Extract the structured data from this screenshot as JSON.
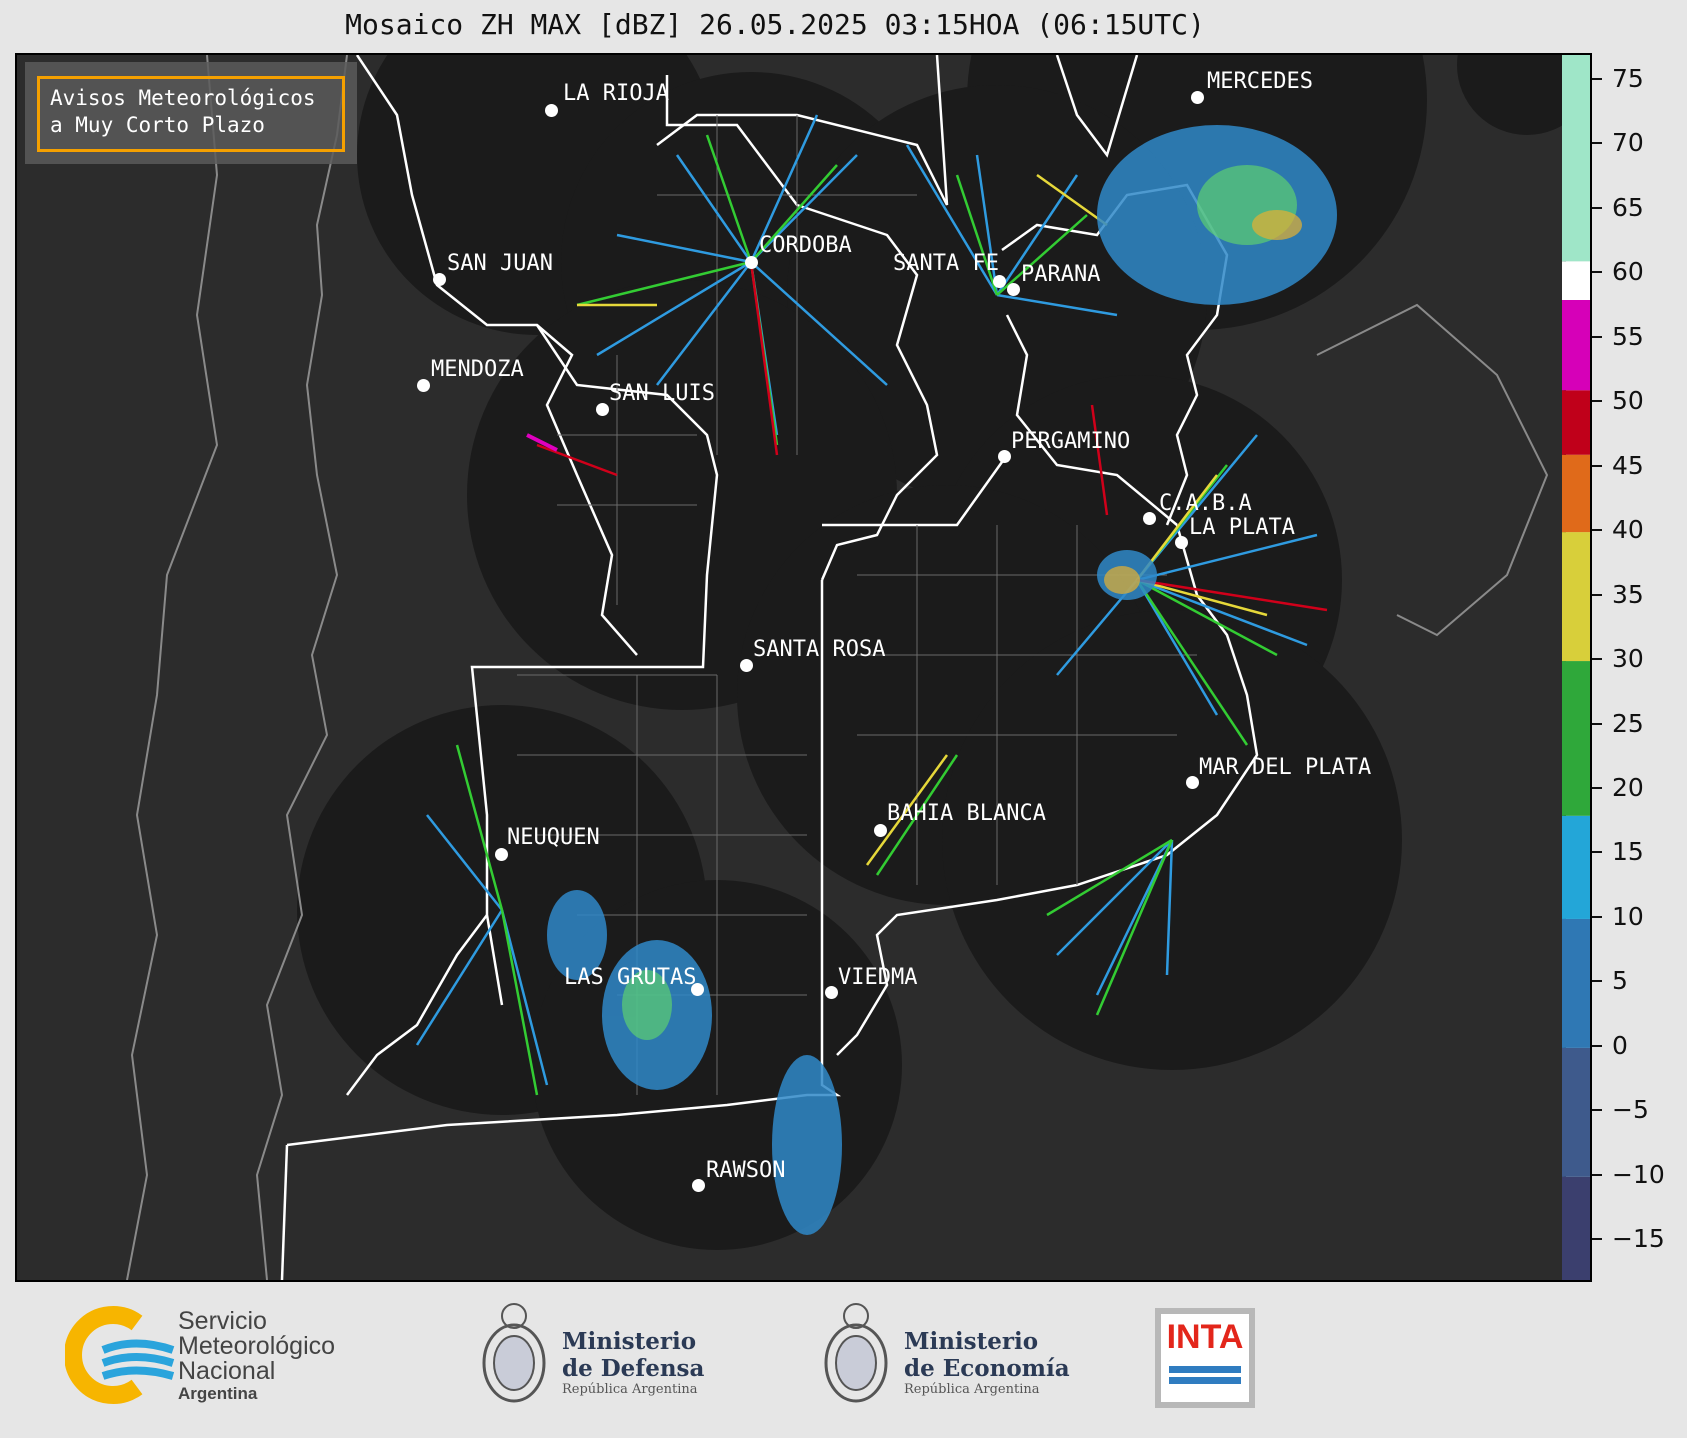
{
  "title": "Mosaico ZH MAX [dBZ] 26.05.2025 03:15HOA (06:15UTC)",
  "avisos": {
    "line1": "Avisos Meteorológicos",
    "line2": "a Muy Corto Plazo"
  },
  "cities": [
    {
      "name": "LA RIOJA"
    },
    {
      "name": "MERCEDES"
    },
    {
      "name": "CORDOBA"
    },
    {
      "name": "SAN JUAN"
    },
    {
      "name": "SANTA FE"
    },
    {
      "name": "PARANA"
    },
    {
      "name": "MENDOZA"
    },
    {
      "name": "SAN LUIS"
    },
    {
      "name": "PERGAMINO"
    },
    {
      "name": "C.A.B.A"
    },
    {
      "name": "LA PLATA"
    },
    {
      "name": "SANTA ROSA"
    },
    {
      "name": "MAR DEL PLATA"
    },
    {
      "name": "BAHIA BLANCA"
    },
    {
      "name": "NEUQUEN"
    },
    {
      "name": "LAS GRUTAS"
    },
    {
      "name": "VIEDMA"
    },
    {
      "name": "RAWSON"
    }
  ],
  "colorbar": {
    "label_unit": "dBZ",
    "min": -18,
    "max": 77,
    "ticks": [
      "75",
      "70",
      "65",
      "60",
      "55",
      "50",
      "45",
      "40",
      "35",
      "30",
      "25",
      "20",
      "15",
      "10",
      "5",
      "0",
      "−5",
      "−10",
      "−15"
    ],
    "tick_values": [
      75,
      70,
      65,
      60,
      55,
      50,
      45,
      40,
      35,
      30,
      25,
      20,
      15,
      10,
      5,
      0,
      -5,
      -10,
      -15
    ],
    "bands": [
      {
        "from": -18,
        "to": -10,
        "color": "#3b3f6e"
      },
      {
        "from": -10,
        "to": 0,
        "color": "#3e5a8c"
      },
      {
        "from": 0,
        "to": 10,
        "color": "#2f78b4"
      },
      {
        "from": 10,
        "to": 18,
        "color": "#23a6d8"
      },
      {
        "from": 18,
        "to": 30,
        "color": "#2fa83a"
      },
      {
        "from": 30,
        "to": 40,
        "color": "#d8cf3a"
      },
      {
        "from": 40,
        "to": 46,
        "color": "#e06a1a"
      },
      {
        "from": 46,
        "to": 51,
        "color": "#c0001a"
      },
      {
        "from": 51,
        "to": 58,
        "color": "#d600b8"
      },
      {
        "from": 58,
        "to": 61,
        "color": "#ffffff"
      },
      {
        "from": 61,
        "to": 77,
        "color": "#9fe6c8"
      }
    ]
  },
  "logos": {
    "smn": {
      "line1": "Servicio",
      "line2": "Meteorológico",
      "line3": "Nacional",
      "line4": "Argentina"
    },
    "defensa": {
      "line1": "Ministerio",
      "line2": "de Defensa",
      "line3": "República Argentina"
    },
    "economia": {
      "line1": "Ministerio",
      "line2": "de Economía",
      "line3": "República Argentina"
    },
    "inta": {
      "text": "INTA"
    }
  }
}
